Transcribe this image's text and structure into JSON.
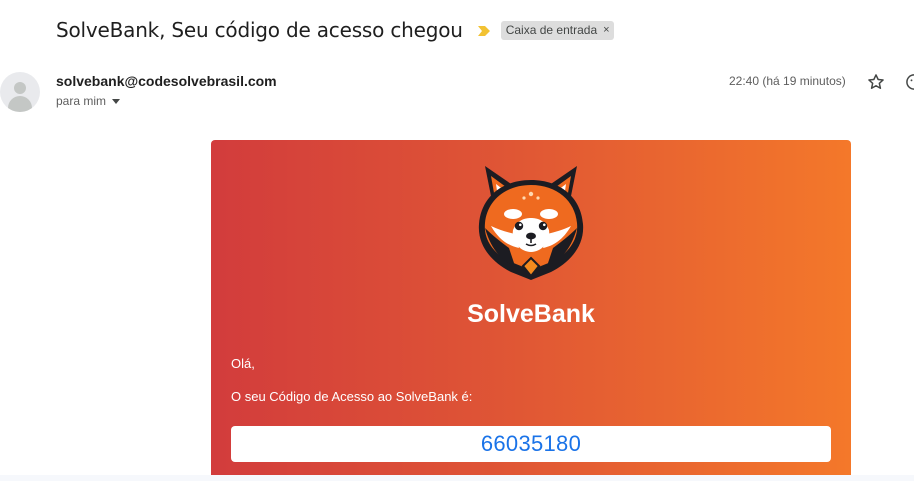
{
  "email": {
    "subject": "SolveBank, Seu código de acesso chegou",
    "label": "Caixa de entrada",
    "label_close": "×",
    "sender": "solvebank@codesolvebrasil.com",
    "recipient": "para mim",
    "timestamp": "22:40 (há 19 minutos)"
  },
  "icons": {
    "importance": "importance-marker-icon",
    "avatar": "default-avatar-icon",
    "star": "star-icon",
    "emoji": "emoji-react-icon",
    "caret": "chevron-down-icon",
    "logo": "red-panda-logo"
  },
  "body": {
    "brand": "SolveBank",
    "greeting": "Olá,",
    "message": "O seu Código de Acesso ao SolveBank é:",
    "code": "66035180"
  },
  "colors": {
    "gradient_start": "#d23c3c",
    "gradient_end": "#f4782a",
    "code_text": "#1a73e8",
    "importance": "#f2c233"
  }
}
